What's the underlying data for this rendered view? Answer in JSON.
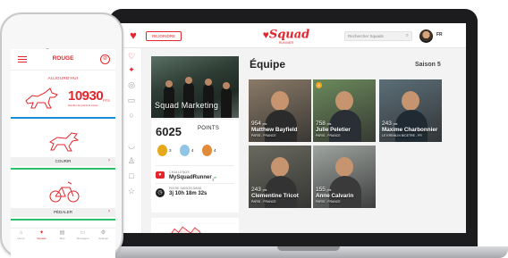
{
  "laptop": {
    "topbar": {
      "join_button": "REJOINDRE",
      "brand_name": "Squad",
      "brand_sub": "RUNNER",
      "search_placeholder": "Rechercher Squads",
      "lang": "FR"
    },
    "sidebar_icons": [
      "heart-icon",
      "wolf-icon",
      "target-icon",
      "message-icon",
      "search-icon",
      "shoe-icon",
      "trophy-icon",
      "bag-icon",
      "star-icon"
    ],
    "profile": {
      "squad_name": "Squad Marketing"
    },
    "points": {
      "total": "6025",
      "label": "POINTS",
      "medals": [
        {
          "type": "gold",
          "color": "#e6a91c",
          "count": "3"
        },
        {
          "type": "silver",
          "color": "#8fc6e6",
          "count": "4"
        },
        {
          "type": "bronze",
          "color": "#e08a3a",
          "count": "4"
        }
      ],
      "challenge_label": "CHALLENGE",
      "challenge_name": "MySquadRunner",
      "challenge_rank": "1",
      "challenge_rank_suffix": "er",
      "end_label": "FIN DE SAISON DANS",
      "end_timer": "3j  10h  18m  32s"
    },
    "team": {
      "title": "Équipe",
      "season": "Saison 5",
      "members": [
        {
          "name": "Matthew Bayfield",
          "points": "954",
          "points_unit": "pts",
          "location": "PARIS - FRANCE",
          "bg": "#8a7a68",
          "shirt": "#2b2b2b"
        },
        {
          "name": "Julie Peletier",
          "points": "758",
          "points_unit": "pts",
          "location": "PARIS - FRANCE",
          "bg": "#6c8a5c",
          "shirt": "#2a2f36",
          "badge": "4"
        },
        {
          "name": "Maxime Charbonnier",
          "points": "243",
          "points_unit": "pts",
          "location": "LE KREMLIN BICETRE - FR",
          "bg": "#5c6e78",
          "shirt": "#1f2a33"
        },
        {
          "name": "Clementine Tricot",
          "points": "243",
          "points_unit": "pts",
          "location": "PARIS - FRANCE",
          "bg": "#6a6a60",
          "shirt": "#333333"
        },
        {
          "name": "Anne Calvarin",
          "points": "155",
          "points_unit": "pts",
          "location": "PARIS - FRANCE",
          "bg": "#9ea4a0",
          "shirt": "#3a3a3a"
        }
      ]
    },
    "chart_data": {
      "type": "area",
      "title": "",
      "xlabel": "",
      "ylabel": "",
      "x": [
        0,
        1,
        2,
        3,
        4,
        5,
        6,
        7,
        8,
        9,
        10,
        11,
        12,
        13,
        14,
        15,
        16,
        17,
        18,
        19
      ],
      "values": [
        12,
        20,
        34,
        40,
        55,
        46,
        60,
        52,
        44,
        58,
        50,
        36,
        42,
        30,
        24,
        32,
        18,
        14,
        22,
        10
      ],
      "ylim": [
        0,
        70
      ]
    }
  },
  "phone": {
    "title": "ROUGE",
    "today_label": "AUJOURD'HUI",
    "points_today": "10930",
    "points_unit": "PTS",
    "points_sub": "Nombre de points le même",
    "activities": [
      {
        "label": "COURIR"
      },
      {
        "label": "PÉDALER"
      }
    ],
    "tabs": [
      {
        "icon": "home-icon",
        "label": "Home",
        "active": false
      },
      {
        "icon": "wolf-icon",
        "label": "Squads",
        "active": true
      },
      {
        "icon": "map-icon",
        "label": "Map",
        "active": false
      },
      {
        "icon": "message-icon",
        "label": "Messages",
        "active": false
      },
      {
        "icon": "gear-icon",
        "label": "Settings",
        "active": false
      }
    ]
  }
}
